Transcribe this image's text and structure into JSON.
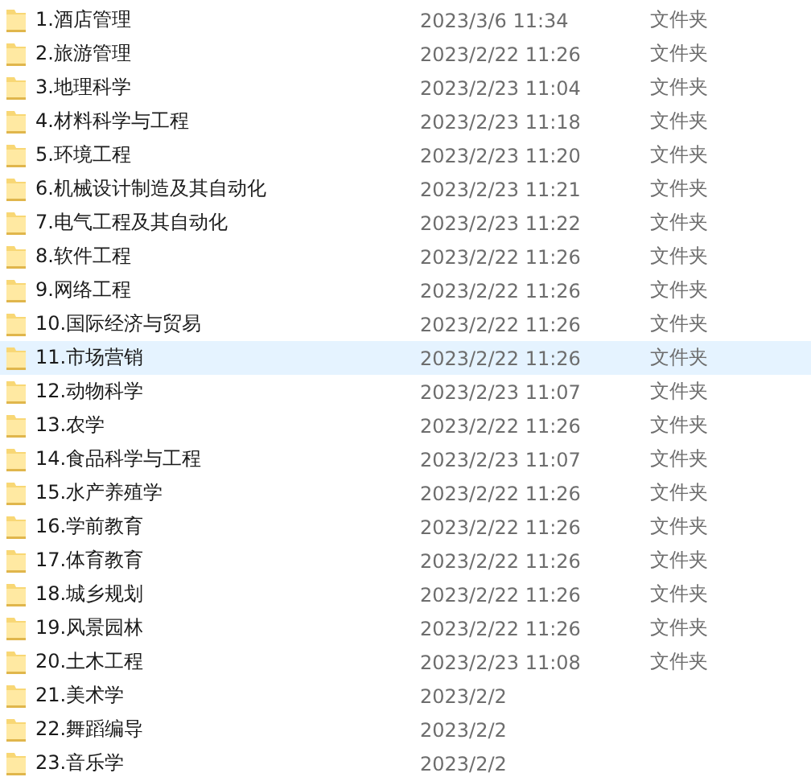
{
  "files": [
    {
      "name": "1.酒店管理",
      "modified": "2023/3/6 11:34",
      "type": "文件夹",
      "selected": false
    },
    {
      "name": "2.旅游管理",
      "modified": "2023/2/22 11:26",
      "type": "文件夹",
      "selected": false
    },
    {
      "name": "3.地理科学",
      "modified": "2023/2/23 11:04",
      "type": "文件夹",
      "selected": false
    },
    {
      "name": "4.材料科学与工程",
      "modified": "2023/2/23 11:18",
      "type": "文件夹",
      "selected": false
    },
    {
      "name": "5.环境工程",
      "modified": "2023/2/23 11:20",
      "type": "文件夹",
      "selected": false
    },
    {
      "name": "6.机械设计制造及其自动化",
      "modified": "2023/2/23 11:21",
      "type": "文件夹",
      "selected": false
    },
    {
      "name": "7.电气工程及其自动化",
      "modified": "2023/2/23 11:22",
      "type": "文件夹",
      "selected": false
    },
    {
      "name": "8.软件工程",
      "modified": "2023/2/22 11:26",
      "type": "文件夹",
      "selected": false
    },
    {
      "name": "9.网络工程",
      "modified": "2023/2/22 11:26",
      "type": "文件夹",
      "selected": false
    },
    {
      "name": "10.国际经济与贸易",
      "modified": "2023/2/22 11:26",
      "type": "文件夹",
      "selected": false
    },
    {
      "name": "11.市场营销",
      "modified": "2023/2/22 11:26",
      "type": "文件夹",
      "selected": true
    },
    {
      "name": "12.动物科学",
      "modified": "2023/2/23 11:07",
      "type": "文件夹",
      "selected": false
    },
    {
      "name": "13.农学",
      "modified": "2023/2/22 11:26",
      "type": "文件夹",
      "selected": false
    },
    {
      "name": "14.食品科学与工程",
      "modified": "2023/2/23 11:07",
      "type": "文件夹",
      "selected": false
    },
    {
      "name": "15.水产养殖学",
      "modified": "2023/2/22 11:26",
      "type": "文件夹",
      "selected": false
    },
    {
      "name": "16.学前教育",
      "modified": "2023/2/22 11:26",
      "type": "文件夹",
      "selected": false
    },
    {
      "name": "17.体育教育",
      "modified": "2023/2/22 11:26",
      "type": "文件夹",
      "selected": false
    },
    {
      "name": "18.城乡规划",
      "modified": "2023/2/22 11:26",
      "type": "文件夹",
      "selected": false
    },
    {
      "name": "19.风景园林",
      "modified": "2023/2/22 11:26",
      "type": "文件夹",
      "selected": false
    },
    {
      "name": "20.土木工程",
      "modified": "2023/2/23 11:08",
      "type": "文件夹",
      "selected": false
    },
    {
      "name": "21.美术学",
      "modified": "2023/2/2",
      "selected": false
    },
    {
      "name": "22.舞蹈编导",
      "modified": "2023/2/2",
      "selected": false
    },
    {
      "name": "23.音乐学",
      "modified": "2023/2/2",
      "selected": false
    }
  ]
}
